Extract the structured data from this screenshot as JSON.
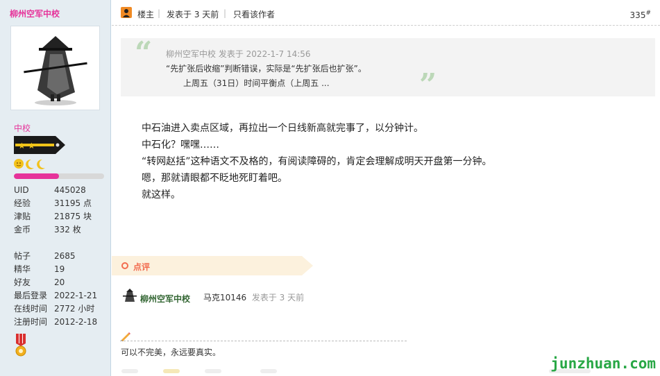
{
  "sidebar": {
    "username": "柳州空军中校",
    "rank": "中校",
    "stars": "🌝🌙🌙",
    "progress": 0.5,
    "stats": [
      {
        "label": "UID",
        "value": "445028"
      },
      {
        "label": "经验",
        "value": "31195 点"
      },
      {
        "label": "津贴",
        "value": "21875 块"
      },
      {
        "label": "金币",
        "value": "332 枚"
      }
    ],
    "stats2": [
      {
        "label": "帖子",
        "value": "2685"
      },
      {
        "label": "精华",
        "value": "19"
      },
      {
        "label": "好友",
        "value": "20"
      },
      {
        "label": "最后登录",
        "value": "2022-1-21"
      },
      {
        "label": "在线时间",
        "value": "2772 小时"
      },
      {
        "label": "注册时间",
        "value": "2012-2-18"
      }
    ]
  },
  "post": {
    "host_label": "楼主",
    "posted": "发表于 3 天前",
    "only_author": "只看该作者",
    "floor": "335",
    "floor_mark": "#"
  },
  "quote": {
    "author": "柳州空军中校",
    "meta": "发表于 2022-1-7 14:56",
    "line1": "“先扩张后收缩”判断错误，实际是“先扩张后也扩张”。",
    "line2": "上周五（31日）时间平衡点（上周五 ..."
  },
  "content": [
    "中石油进入卖点区域，再拉出一个日线新高就完事了，以分钟计。",
    "中石化？嘿嘿……",
    "“转网赵括”这种语文不及格的，有阅读障碍的，肯定会理解成明天开盘第一分钟。",
    "嗯，那就请眼都不眨地死盯着吧。",
    "就这样。"
  ],
  "rating": {
    "label": "点评",
    "user": "柳州空军中校",
    "commenter": "马克10146",
    "time": "发表于 3 天前"
  },
  "signature": "可以不完美，永远要真实。",
  "watermark": "junzhuan.com",
  "colors": {
    "username": "#e6339a",
    "accent": "#f26c4f",
    "quote_mark": "#bcd8b8",
    "watermark": "#28a745"
  }
}
